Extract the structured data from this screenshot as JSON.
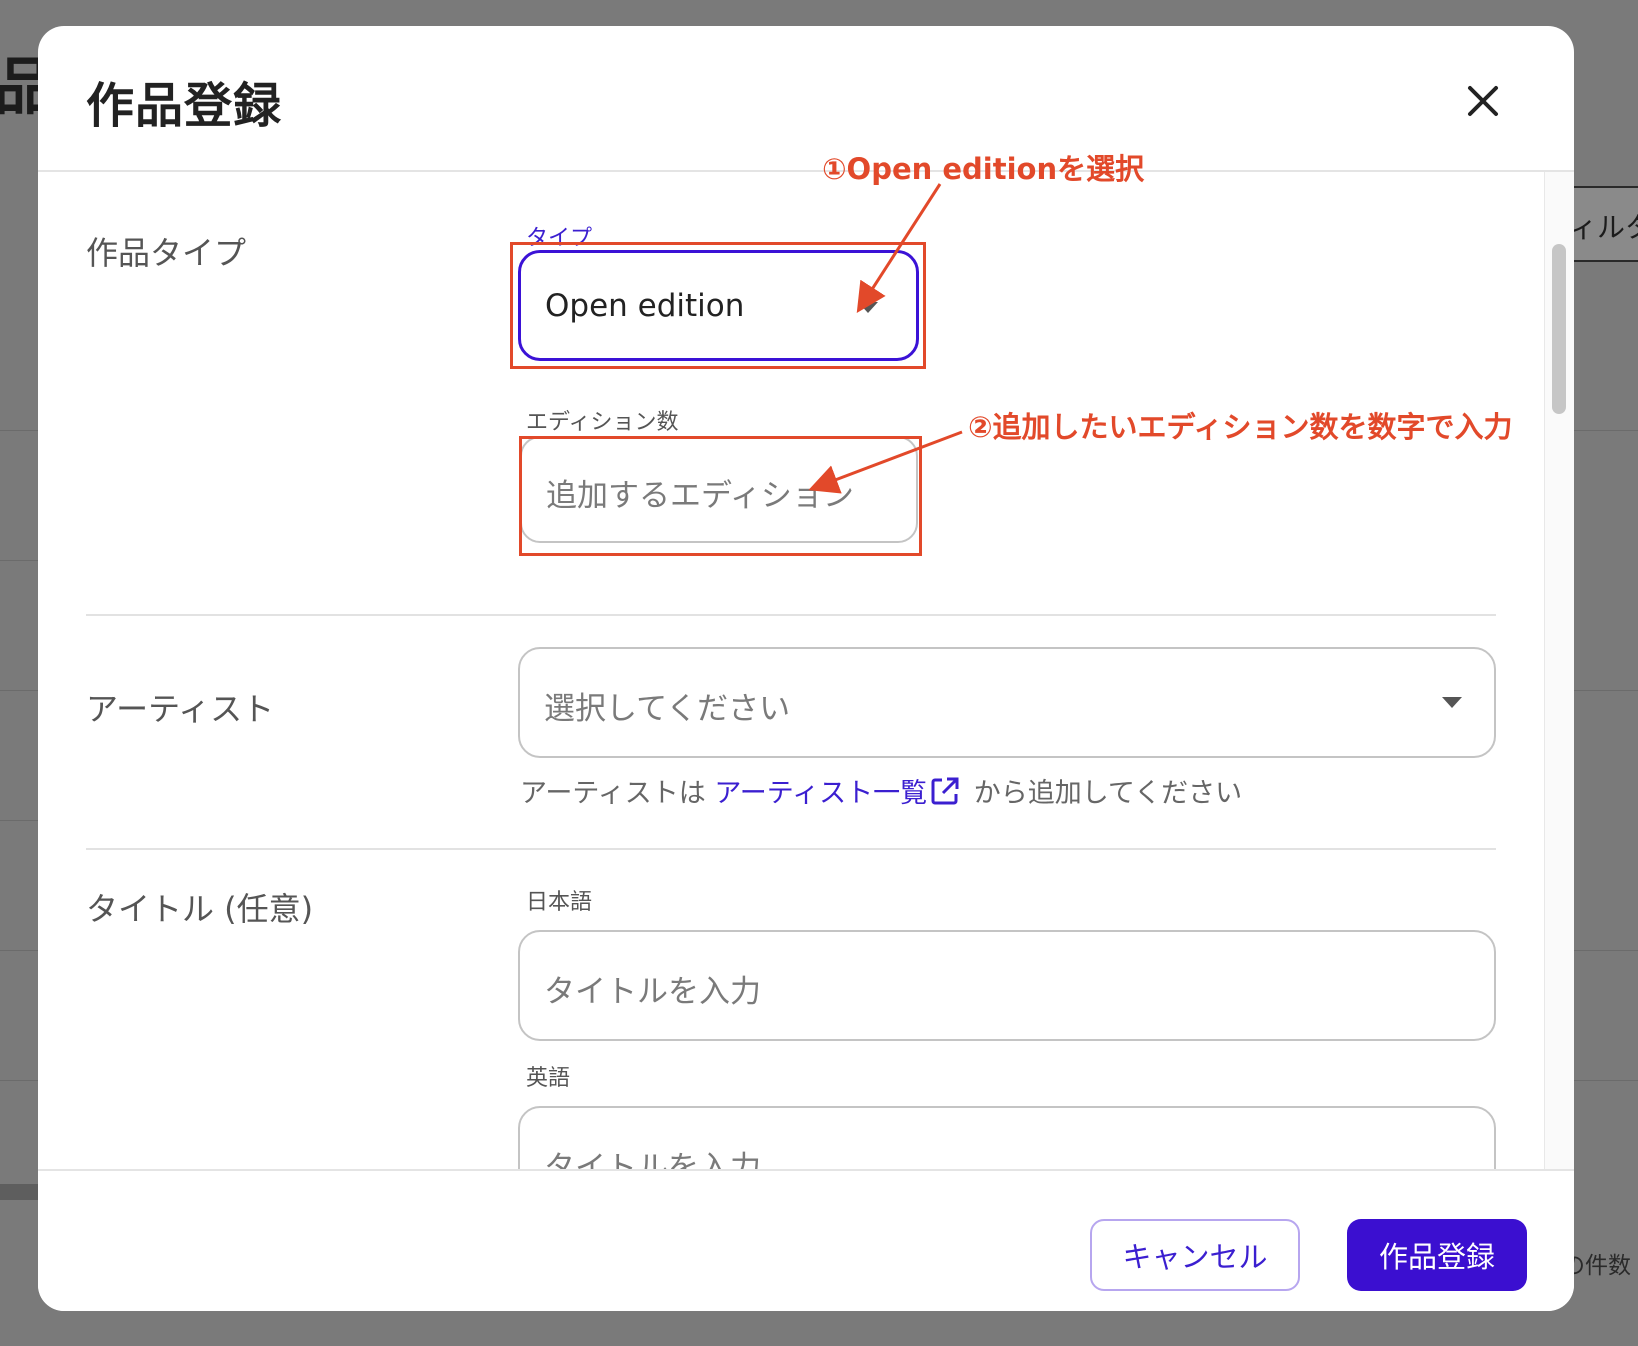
{
  "background": {
    "page_title_fragment": "品",
    "filter_fragment": "ィルタ",
    "count_fragment": "の件数"
  },
  "modal": {
    "title": "作品登録",
    "sections": {
      "work_type": {
        "label": "作品タイプ",
        "type_field": {
          "label": "タイプ",
          "value": "Open edition"
        },
        "edition_field": {
          "label": "エディション数",
          "placeholder": "追加するエディション"
        }
      },
      "artist": {
        "label": "アーティスト",
        "select_placeholder": "選択してください",
        "helper_prefix": "アーティストは",
        "helper_link": "アーティスト一覧",
        "helper_suffix": "から追加してください"
      },
      "title": {
        "label": "タイトル (任意)",
        "japanese": {
          "label": "日本語",
          "placeholder": "タイトルを入力"
        },
        "english": {
          "label": "英語",
          "placeholder": "タイトルを入力"
        }
      }
    },
    "footer": {
      "cancel_label": "キャンセル",
      "submit_label": "作品登録"
    }
  },
  "annotations": {
    "step1": "①Open editionを選択",
    "step2": "②追加したいエディション数を数字で入力",
    "color": "#e2492a"
  },
  "colors": {
    "accent": "#3b0fd0",
    "link": "#3b1fd0",
    "overlay": "#7a7a7a"
  },
  "icons": [
    "close-icon",
    "chevron-down-icon",
    "external-link-icon"
  ]
}
